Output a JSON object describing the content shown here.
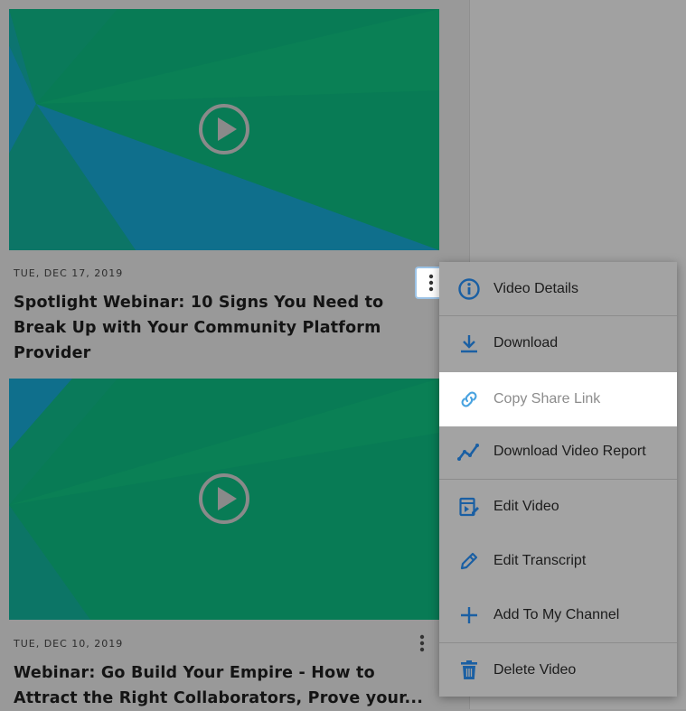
{
  "colors": {
    "overlay_bg": "#999999",
    "thumb_green": "#087b55",
    "thumb_blue": "#0f6f8c",
    "icon_blue": "#1a5fa3",
    "menu_bg": "#a3a3a3",
    "highlight": "#ffffff"
  },
  "videos": [
    {
      "date": "TUE, DEC 17, 2019",
      "title": "Spotlight Webinar: 10 Signs You Need to Break Up with Your Community Platform Provider",
      "play_icon": "play-circle-icon",
      "menu_icon": "more-vertical-icon"
    },
    {
      "date": "TUE, DEC 10, 2019",
      "title": "Webinar: Go Build Your Empire - How to Attract the Right Collaborators, Prove your...",
      "play_icon": "play-circle-icon",
      "menu_icon": "more-vertical-icon"
    }
  ],
  "context_menu": {
    "items": [
      {
        "label": "Video Details",
        "icon": "info-circle-icon"
      },
      {
        "label": "Download",
        "icon": "download-icon"
      },
      {
        "label": "Copy Share Link",
        "icon": "link-icon",
        "active": true
      },
      {
        "label": "Download Video Report",
        "icon": "chart-line-icon"
      },
      {
        "label": "Edit Video",
        "icon": "edit-video-icon"
      },
      {
        "label": "Edit Transcript",
        "icon": "pencil-icon"
      },
      {
        "label": "Add To My Channel",
        "icon": "plus-icon"
      },
      {
        "label": "Delete Video",
        "icon": "trash-icon"
      }
    ]
  }
}
